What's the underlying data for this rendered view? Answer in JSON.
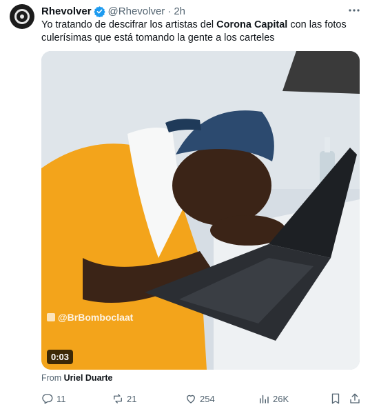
{
  "tweet": {
    "display_name": "Rhevolver",
    "handle": "@Rhevolver",
    "separator": "·",
    "time": "2h",
    "text_before": "Yo tratando de descifrar los artistas del ",
    "text_bold": "Corona Capital",
    "text_after": " con las fotos culerísimas que está tomando la gente a los carteles",
    "verified_icon": "verified-badge-icon",
    "verified_color": "#1d9bf0"
  },
  "media": {
    "duration": "0:03",
    "watermark": "@BrBomboclaat"
  },
  "from": {
    "prefix": "From ",
    "name": "Uriel Duarte"
  },
  "actions": {
    "replies": "11",
    "reposts": "21",
    "likes": "254",
    "views": "26K"
  },
  "colors": {
    "text_primary": "#0f1419",
    "text_secondary": "#536471",
    "accent": "#1d9bf0"
  }
}
